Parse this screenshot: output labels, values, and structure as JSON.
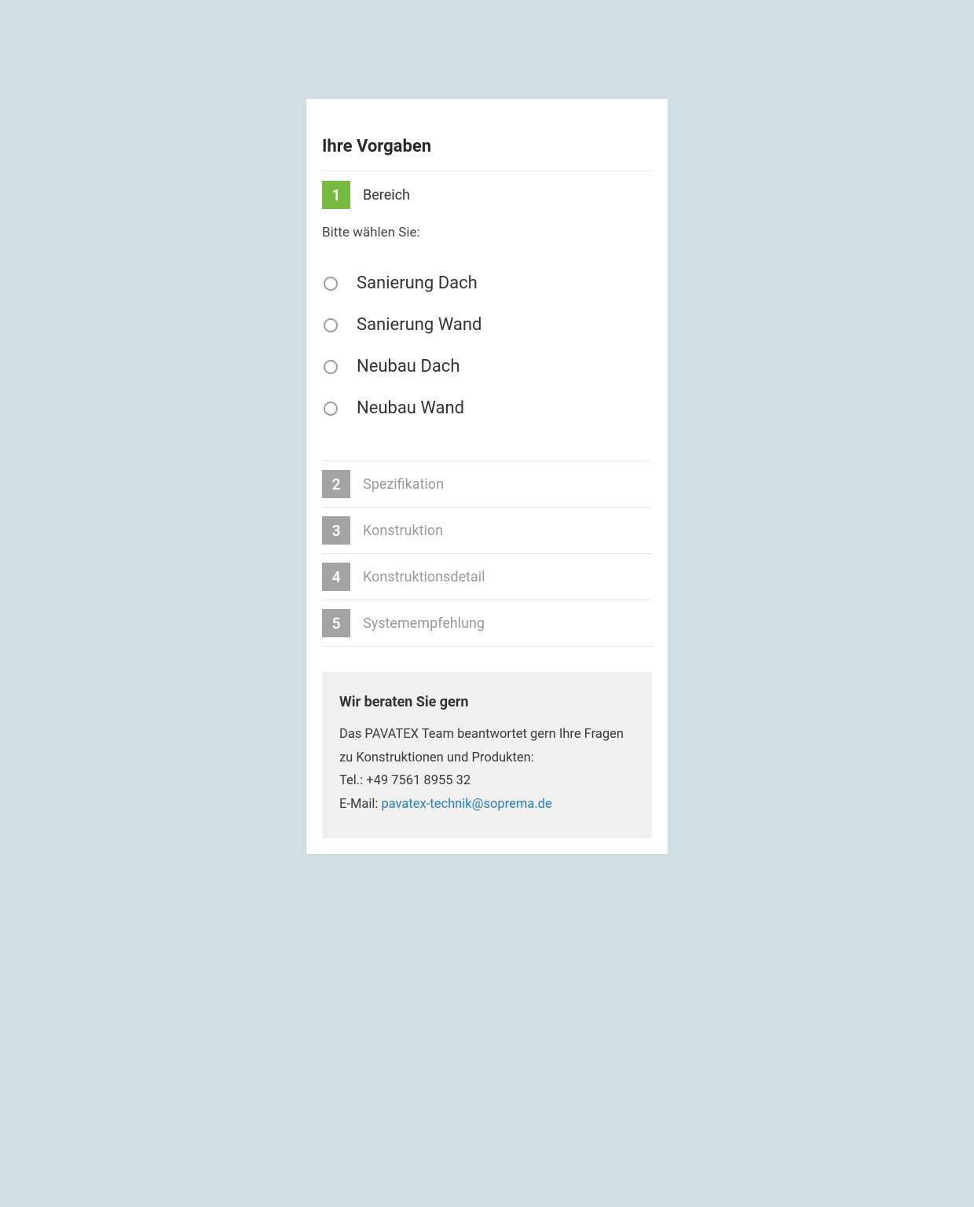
{
  "title": "Ihre Vorgaben",
  "activeStep": {
    "number": "1",
    "label": "Bereich"
  },
  "prompt": "Bitte wählen Sie:",
  "options": [
    {
      "label": "Sanierung Dach"
    },
    {
      "label": "Sanierung Wand"
    },
    {
      "label": "Neubau Dach"
    },
    {
      "label": "Neubau Wand"
    }
  ],
  "inactiveSteps": [
    {
      "number": "2",
      "label": "Spezifikation"
    },
    {
      "number": "3",
      "label": "Konstruktion"
    },
    {
      "number": "4",
      "label": "Konstruktionsdetail"
    },
    {
      "number": "5",
      "label": "Systemempfehlung"
    }
  ],
  "infoBox": {
    "title": "Wir beraten Sie gern",
    "line1": "Das PAVATEX Team beantwortet gern Ihre Fragen zu Konstruktionen und Produkten:",
    "line2_prefix": "Tel.: ",
    "tel": "+49 7561 8955 32",
    "line3_prefix": "E-Mail: ",
    "email": "pavatex-technik@soprema.de"
  }
}
